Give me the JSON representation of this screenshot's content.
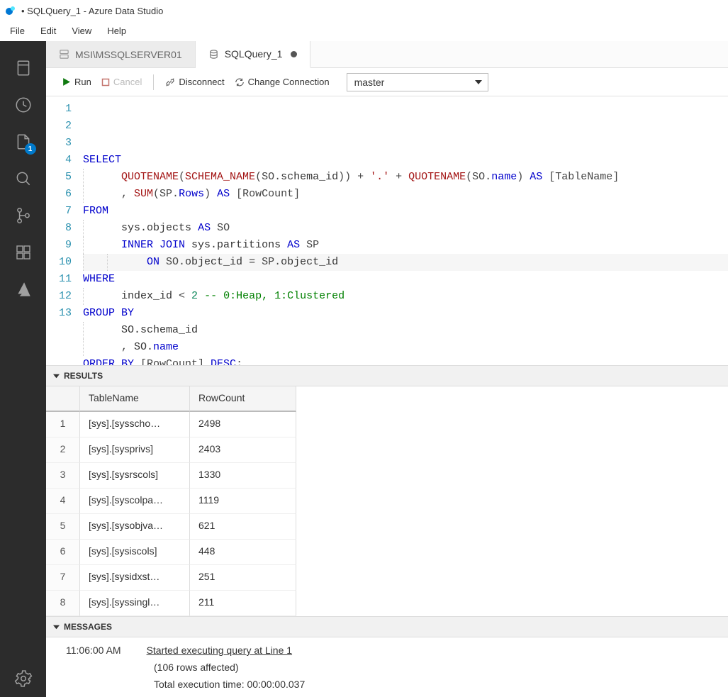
{
  "title": "• SQLQuery_1 - Azure Data Studio",
  "menu": [
    "File",
    "Edit",
    "View",
    "Help"
  ],
  "activity_badge": "1",
  "tabs": [
    {
      "label": "MSI\\MSSQLSERVER01",
      "active": false,
      "dirty": false
    },
    {
      "label": "SQLQuery_1",
      "active": true,
      "dirty": true
    }
  ],
  "toolbar": {
    "run": "Run",
    "cancel": "Cancel",
    "disconnect": "Disconnect",
    "change_connection": "Change Connection",
    "db_selected": "master"
  },
  "code_lines": [
    [
      {
        "c": "kw",
        "t": "SELECT"
      }
    ],
    [
      {
        "c": "",
        "t": "      "
      },
      {
        "c": "fn",
        "t": "QUOTENAME"
      },
      {
        "c": "op",
        "t": "("
      },
      {
        "c": "fn",
        "t": "SCHEMA_NAME"
      },
      {
        "c": "op",
        "t": "(SO."
      },
      {
        "c": "id",
        "t": "schema_id"
      },
      {
        "c": "op",
        "t": ")) + "
      },
      {
        "c": "str",
        "t": "'.'"
      },
      {
        "c": "op",
        "t": " + "
      },
      {
        "c": "fn",
        "t": "QUOTENAME"
      },
      {
        "c": "op",
        "t": "(SO."
      },
      {
        "c": "kw",
        "t": "name"
      },
      {
        "c": "op",
        "t": ") "
      },
      {
        "c": "kw",
        "t": "AS"
      },
      {
        "c": "op",
        "t": " [TableName]"
      }
    ],
    [
      {
        "c": "",
        "t": "      "
      },
      {
        "c": "op",
        "t": ", "
      },
      {
        "c": "fn",
        "t": "SUM"
      },
      {
        "c": "op",
        "t": "(SP."
      },
      {
        "c": "kw",
        "t": "Rows"
      },
      {
        "c": "op",
        "t": ") "
      },
      {
        "c": "kw",
        "t": "AS"
      },
      {
        "c": "op",
        "t": " [RowCount]"
      }
    ],
    [
      {
        "c": "kw",
        "t": "FROM"
      }
    ],
    [
      {
        "c": "",
        "t": "      "
      },
      {
        "c": "id",
        "t": "sys.objects"
      },
      {
        "c": "op",
        "t": " "
      },
      {
        "c": "kw",
        "t": "AS"
      },
      {
        "c": "op",
        "t": " SO"
      }
    ],
    [
      {
        "c": "",
        "t": "      "
      },
      {
        "c": "kw",
        "t": "INNER JOIN"
      },
      {
        "c": "op",
        "t": " "
      },
      {
        "c": "id",
        "t": "sys.partitions"
      },
      {
        "c": "op",
        "t": " "
      },
      {
        "c": "kw",
        "t": "AS"
      },
      {
        "c": "op",
        "t": " SP"
      }
    ],
    [
      {
        "c": "",
        "t": "          "
      },
      {
        "c": "kw",
        "t": "ON"
      },
      {
        "c": "op",
        "t": " SO."
      },
      {
        "c": "id",
        "t": "object_id"
      },
      {
        "c": "op",
        "t": " = SP."
      },
      {
        "c": "id",
        "t": "object_id"
      }
    ],
    [
      {
        "c": "kw",
        "t": "WHERE"
      }
    ],
    [
      {
        "c": "",
        "t": "      "
      },
      {
        "c": "id",
        "t": "index_id"
      },
      {
        "c": "op",
        "t": " < "
      },
      {
        "c": "num",
        "t": "2"
      },
      {
        "c": "op",
        "t": " "
      },
      {
        "c": "cmt",
        "t": "-- 0:Heap, 1:Clustered"
      }
    ],
    [
      {
        "c": "kw",
        "t": "GROUP BY"
      }
    ],
    [
      {
        "c": "",
        "t": "      "
      },
      {
        "c": "id",
        "t": "SO.schema_id"
      }
    ],
    [
      {
        "c": "",
        "t": "      "
      },
      {
        "c": "op",
        "t": ", "
      },
      {
        "c": "id",
        "t": "SO."
      },
      {
        "c": "kw",
        "t": "name"
      }
    ],
    [
      {
        "c": "kw",
        "t": "ORDER BY"
      },
      {
        "c": "op",
        "t": " [RowCount] "
      },
      {
        "c": "kw",
        "t": "DESC"
      },
      {
        "c": "op",
        "t": ";"
      }
    ]
  ],
  "results": {
    "header": "RESULTS",
    "columns": [
      "TableName",
      "RowCount"
    ],
    "rows": [
      {
        "n": "1",
        "c": [
          "[sys].[sysscho…",
          "2498"
        ]
      },
      {
        "n": "2",
        "c": [
          "[sys].[sysprivs]",
          "2403"
        ]
      },
      {
        "n": "3",
        "c": [
          "[sys].[sysrscols]",
          "1330"
        ]
      },
      {
        "n": "4",
        "c": [
          "[sys].[syscolpa…",
          "1119"
        ]
      },
      {
        "n": "5",
        "c": [
          "[sys].[sysobjva…",
          "621"
        ]
      },
      {
        "n": "6",
        "c": [
          "[sys].[sysiscols]",
          "448"
        ]
      },
      {
        "n": "7",
        "c": [
          "[sys].[sysidxst…",
          "251"
        ]
      },
      {
        "n": "8",
        "c": [
          "[sys].[syssingl…",
          "211"
        ]
      }
    ]
  },
  "messages": {
    "header": "MESSAGES",
    "time": "11:06:00 AM",
    "line1": "Started executing query at Line 1",
    "line2": "(106 rows affected)",
    "line3": "Total execution time: 00:00:00.037"
  }
}
